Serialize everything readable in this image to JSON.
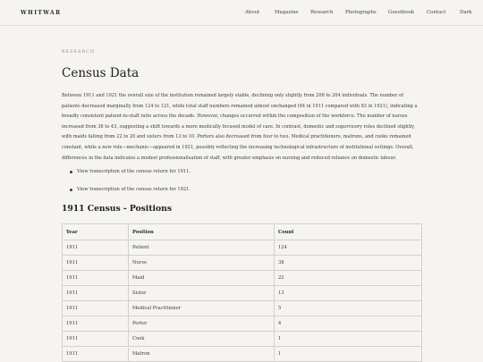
{
  "header": {
    "brand": "WHITWAR",
    "nav": [
      "About",
      "Magazine",
      "Research",
      "Photographs",
      "Guestbook",
      "Contact",
      "Dark"
    ]
  },
  "main": {
    "eyebrow": "RESEARCH",
    "title": "Census Data",
    "paragraph": "Between 1911 and 1921 the overall size of the institution remained largely stable, declining only slightly from 208 to 204 individuals. The number of patients decreased marginally from 124 to 121, while total staff numbers remained almost unchanged (84 in 1911 compared with 83 in 1921), indicating a broadly consistent patient-to-staff ratio across the decade. However, changes occurred within the composition of the workforce. The number of nurses increased from 38 to 43, suggesting a shift towards a more medically focused model of care. In contrast, domestic and supervisory roles declined slightly, with maids falling from 22 to 20 and sisters from 13 to 10. Porters also decreased from four to two. Medical practitioners, matrons, and cooks remained constant, while a new role—mechanic—appeared in 1921, possibly reflecting the increasing technological infrastructure of institutional settings. Overall, differences in the data indicates a modest professionalisation of staff, with greater emphasis on nursing and reduced reliance on domestic labour.",
    "links": [
      "View transcription of the census return for 1911.",
      "View transcription of the census return for 1921."
    ],
    "section_title": "1911 Census - Positions",
    "table": {
      "headers": [
        "Year",
        "Position",
        "Count"
      ],
      "rows": [
        [
          "1911",
          "Patient",
          "124"
        ],
        [
          "1911",
          "Nurse",
          "38"
        ],
        [
          "1911",
          "Maid",
          "22"
        ],
        [
          "1911",
          "Sister",
          "13"
        ],
        [
          "1911",
          "Medical Practitioner",
          "5"
        ],
        [
          "1911",
          "Porter",
          "4"
        ],
        [
          "1911",
          "Cook",
          "1"
        ],
        [
          "1911",
          "Matron",
          "1"
        ],
        [
          "",
          "",
          ""
        ]
      ]
    }
  }
}
